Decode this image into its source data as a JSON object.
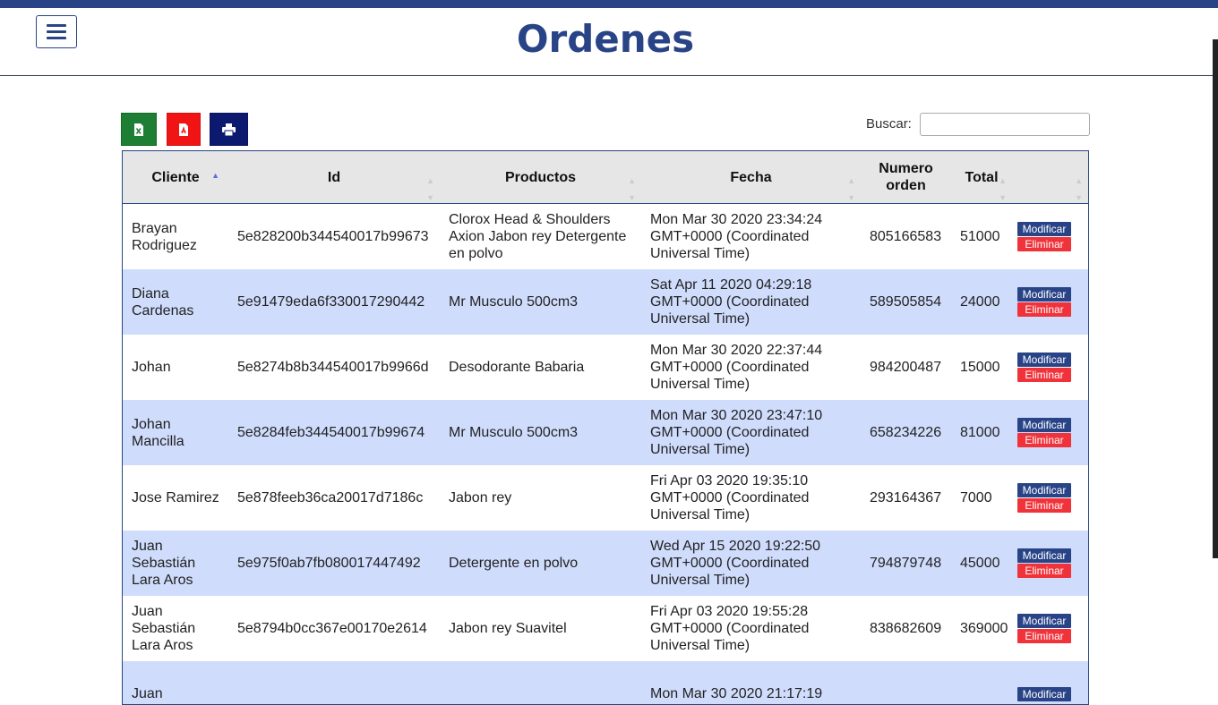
{
  "header": {
    "title": "Ordenes"
  },
  "toolbar": {
    "excel_icon": "file-excel-icon",
    "pdf_icon": "file-pdf-icon",
    "print_icon": "print-icon"
  },
  "search": {
    "label": "Buscar:",
    "value": "",
    "placeholder": ""
  },
  "colors": {
    "primary": "#284487",
    "row_alt": "#cfdcfc",
    "excel": "#1e7e34",
    "pdf": "#f01414",
    "print": "#0b1a6e",
    "delete": "#f0333b"
  },
  "table": {
    "columns": [
      "Cliente",
      "Id",
      "Productos",
      "Fecha",
      "Numero orden",
      "Total",
      ""
    ],
    "sorted_by": "Cliente",
    "rows": [
      {
        "cliente": "Brayan Rodriguez",
        "id": "5e828200b344540017b99673",
        "productos": "Clorox Head & Shoulders Axion Jabon rey Detergente en polvo",
        "fecha": "Mon Mar 30 2020 23:34:24 GMT+0000 (Coordinated Universal Time)",
        "numero": "805166583",
        "total": "51000",
        "modificar": "Modificar",
        "eliminar": "Eliminar"
      },
      {
        "cliente": "Diana Cardenas",
        "id": "5e91479eda6f330017290442",
        "productos": "Mr Musculo 500cm3",
        "fecha": "Sat Apr 11 2020 04:29:18 GMT+0000 (Coordinated Universal Time)",
        "numero": "589505854",
        "total": "24000",
        "modificar": "Modificar",
        "eliminar": "Eliminar"
      },
      {
        "cliente": "Johan",
        "id": "5e8274b8b344540017b9966d",
        "productos": "Desodorante Babaria",
        "fecha": "Mon Mar 30 2020 22:37:44 GMT+0000 (Coordinated Universal Time)",
        "numero": "984200487",
        "total": "15000",
        "modificar": "Modificar",
        "eliminar": "Eliminar"
      },
      {
        "cliente": "Johan Mancilla",
        "id": "5e8284feb344540017b99674",
        "productos": "Mr Musculo 500cm3",
        "fecha": "Mon Mar 30 2020 23:47:10 GMT+0000 (Coordinated Universal Time)",
        "numero": "658234226",
        "total": "81000",
        "modificar": "Modificar",
        "eliminar": "Eliminar"
      },
      {
        "cliente": "Jose Ramirez",
        "id": "5e878feeb36ca20017d7186c",
        "productos": "Jabon rey",
        "fecha": "Fri Apr 03 2020 19:35:10 GMT+0000 (Coordinated Universal Time)",
        "numero": "293164367",
        "total": "7000",
        "modificar": "Modificar",
        "eliminar": "Eliminar"
      },
      {
        "cliente": "Juan Sebastián Lara Aros",
        "id": "5e975f0ab7fb080017447492",
        "productos": "Detergente en polvo",
        "fecha": "Wed Apr 15 2020 19:22:50 GMT+0000 (Coordinated Universal Time)",
        "numero": "794879748",
        "total": "45000",
        "modificar": "Modificar",
        "eliminar": "Eliminar"
      },
      {
        "cliente": "Juan Sebastián Lara Aros",
        "id": "5e8794b0cc367e00170e2614",
        "productos": "Jabon rey Suavitel",
        "fecha": "Fri Apr 03 2020 19:55:28 GMT+0000 (Coordinated Universal Time)",
        "numero": "838682609",
        "total": "369000",
        "modificar": "Modificar",
        "eliminar": "Eliminar"
      },
      {
        "cliente": "Juan",
        "id": "",
        "productos": "",
        "fecha": "Mon Mar 30 2020 21:17:19",
        "numero": "",
        "total": "",
        "modificar": "Modificar",
        "eliminar": ""
      }
    ]
  }
}
